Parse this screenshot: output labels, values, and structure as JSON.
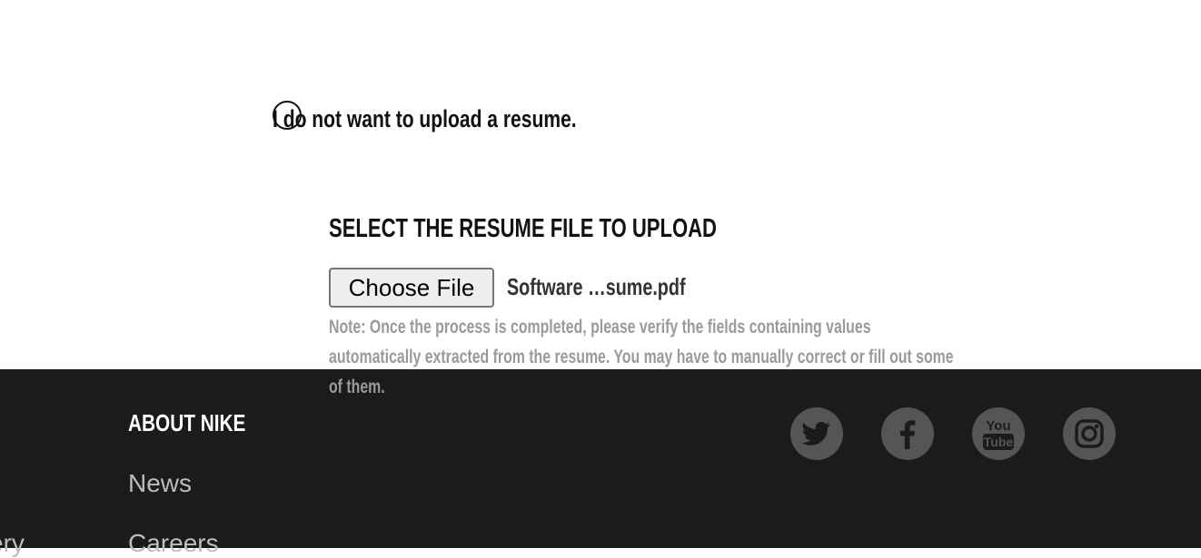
{
  "resume_option": {
    "label": "I do not want to upload a resume."
  },
  "upload": {
    "heading": "SELECT THE RESUME FILE TO UPLOAD",
    "button_label": "Choose File",
    "file_name": "Software …sume.pdf",
    "note": "Note: Once the process is completed, please verify the fields containing values automatically extracted from the resume. You may have to manually correct or fill out some of them."
  },
  "footer": {
    "heading": "ABOUT NIKE",
    "links": [
      "News",
      "Careers"
    ],
    "left_cut_link": "ery",
    "social": [
      "twitter-icon",
      "facebook-icon",
      "youtube-icon",
      "instagram-icon"
    ],
    "youtube_text": [
      "You",
      "Tube"
    ],
    "colors": {
      "background": "#1b1b1b",
      "icon": "#555555",
      "icon_glyph": "#1b1b1b"
    }
  }
}
